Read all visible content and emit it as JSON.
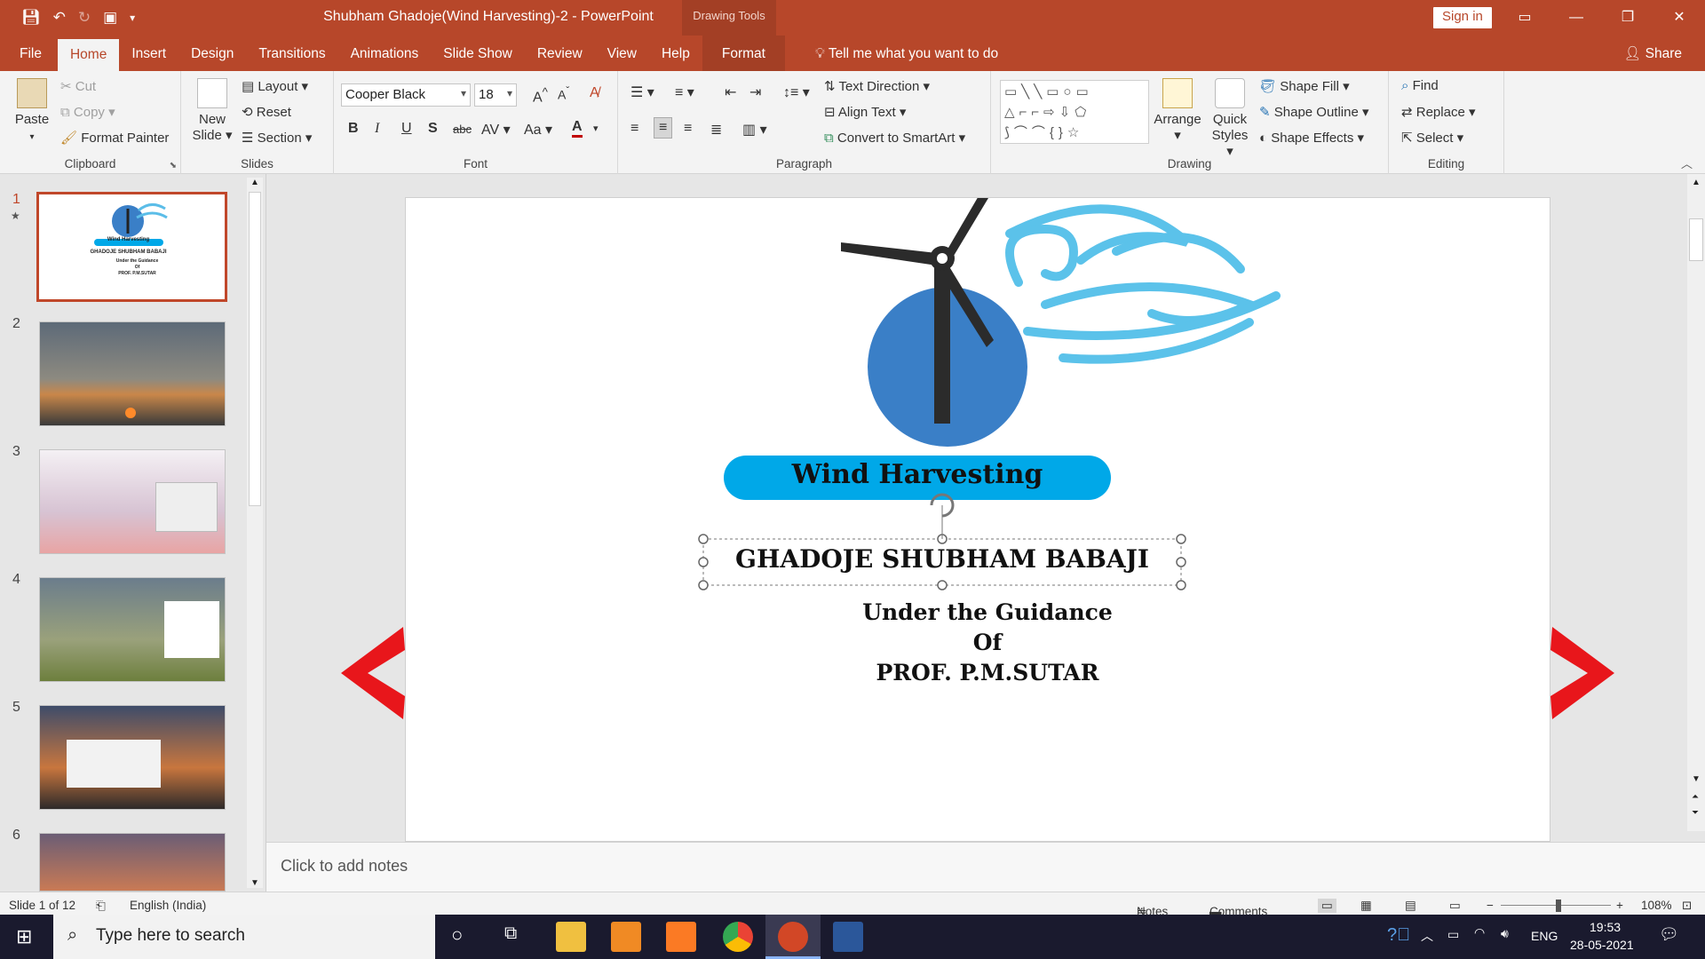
{
  "title_bar": {
    "title": "Shubham Ghadoje(Wind Harvesting)-2  -  PowerPoint",
    "contextual_label": "Drawing Tools",
    "sign_in": "Sign in"
  },
  "tabs": [
    "File",
    "Home",
    "Insert",
    "Design",
    "Transitions",
    "Animations",
    "Slide Show",
    "Review",
    "View",
    "Help",
    "Format"
  ],
  "tell_me": "Tell me what you want to do",
  "share": "Share",
  "ribbon": {
    "clipboard": {
      "paste": "Paste",
      "cut": "Cut",
      "copy": "Copy",
      "format_painter": "Format Painter",
      "label": "Clipboard"
    },
    "slides": {
      "new_slide_1": "New",
      "new_slide_2": "Slide",
      "layout": "Layout",
      "reset": "Reset",
      "section": "Section",
      "label": "Slides"
    },
    "font": {
      "family": "Cooper Black",
      "size": "18",
      "label": "Font"
    },
    "paragraph": {
      "text_direction": "Text Direction",
      "align_text": "Align Text",
      "convert_smartart": "Convert to SmartArt",
      "label": "Paragraph"
    },
    "drawing": {
      "arrange": "Arrange",
      "quick_styles_1": "Quick",
      "quick_styles_2": "Styles",
      "shape_fill": "Shape Fill",
      "shape_outline": "Shape Outline",
      "shape_effects": "Shape Effects",
      "label": "Drawing"
    },
    "editing": {
      "find": "Find",
      "replace": "Replace",
      "select": "Select",
      "label": "Editing"
    }
  },
  "thumbnails": [
    {
      "num": "1",
      "title": "Wind Harvesting",
      "lines": [
        "GHADOJE SHUBHAM BABAJI",
        "Under the Guidance",
        "Of",
        "PROF. P.M.SUTAR"
      ]
    },
    {
      "num": "2"
    },
    {
      "num": "3"
    },
    {
      "num": "4"
    },
    {
      "num": "5"
    },
    {
      "num": "6"
    }
  ],
  "slide": {
    "banner": "Wind Harvesting",
    "author": "GHADOJE SHUBHAM BABAJI",
    "guidance_1": "Under the Guidance",
    "guidance_2": "Of",
    "guidance_3": "PROF. P.M.SUTAR"
  },
  "notes_placeholder": "Click to add notes",
  "status": {
    "slide_info": "Slide 1 of 12",
    "language": "English (India)",
    "notes": "Notes",
    "comments": "Comments",
    "zoom": "108%"
  },
  "taskbar": {
    "search_placeholder": "Type here to search",
    "lang": "ENG",
    "time": "19:53",
    "date": "28-05-2021"
  },
  "colors": {
    "accent": "#b7472a",
    "banner": "#00a8e8",
    "arrow": "#e8161b",
    "globe": "#3a7fc7"
  }
}
